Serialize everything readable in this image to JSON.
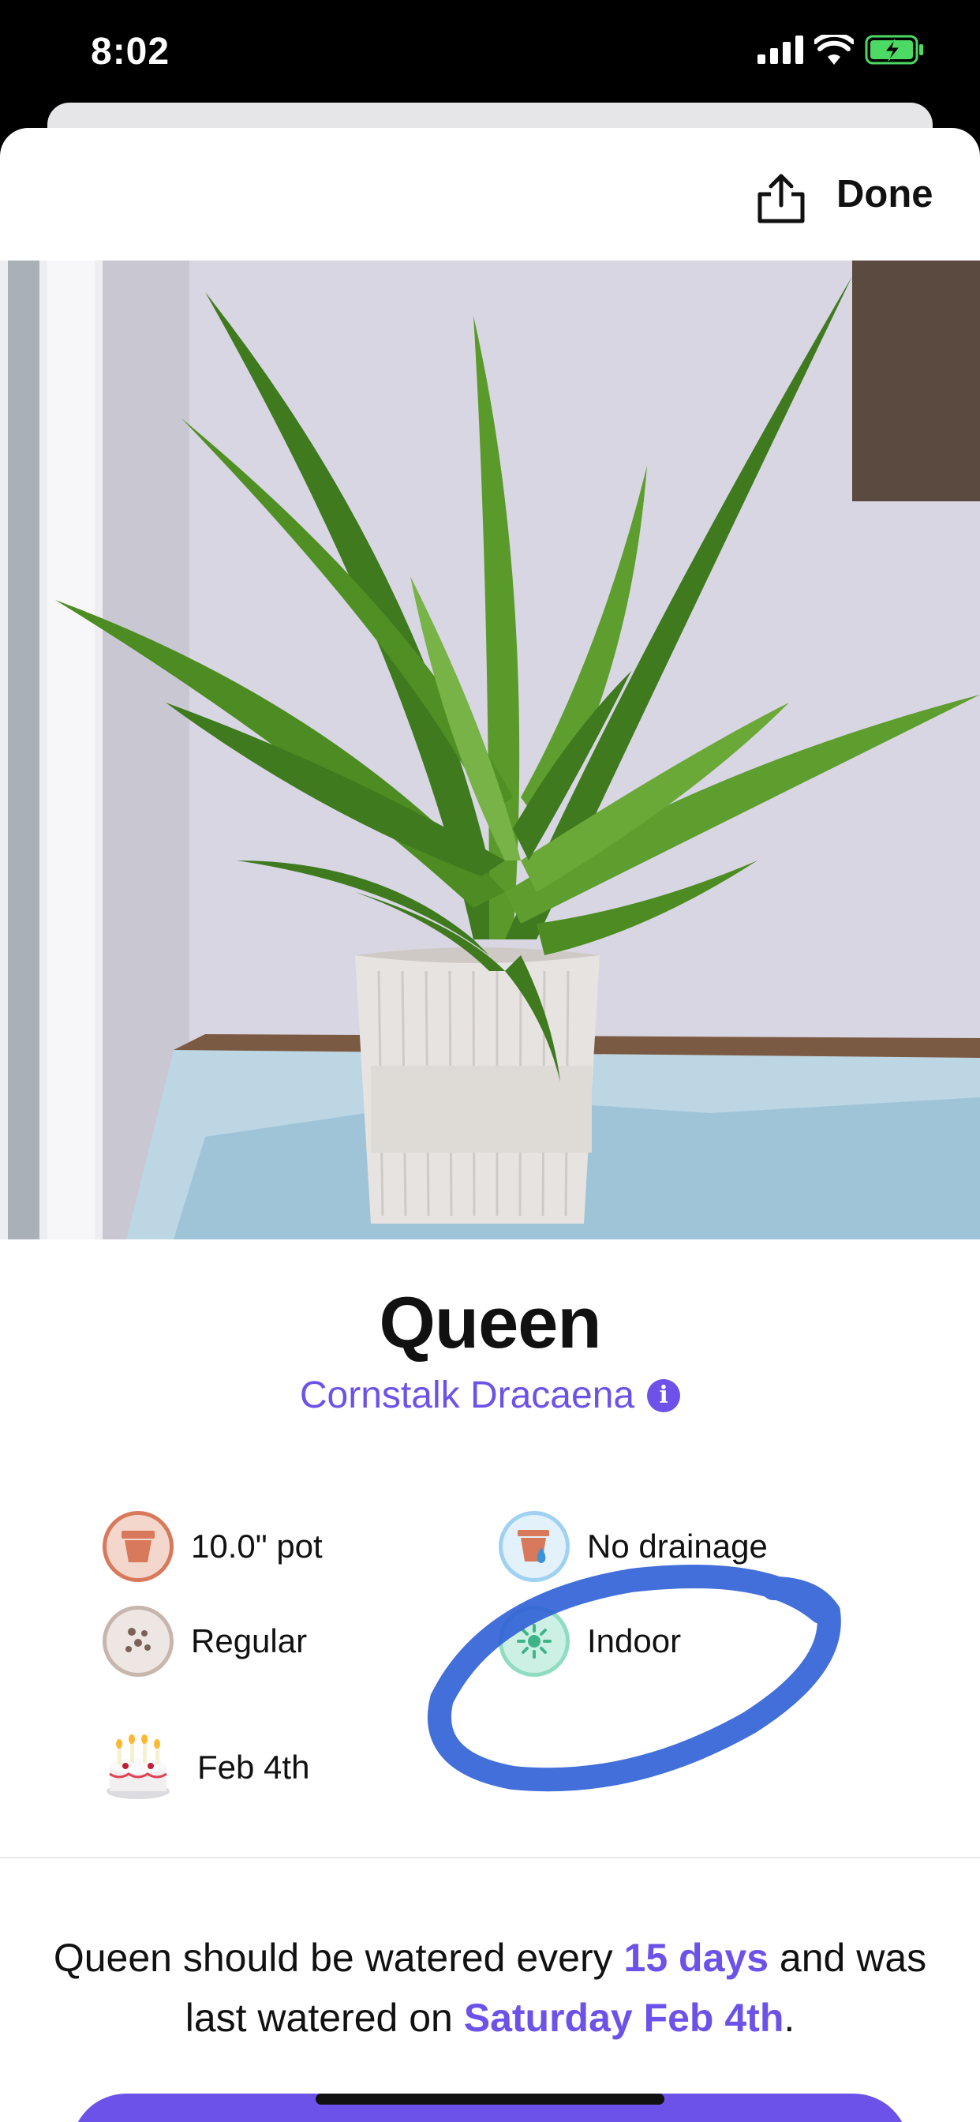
{
  "status_bar": {
    "time": "8:02"
  },
  "header": {
    "done_label": "Done"
  },
  "plant": {
    "name": "Queen",
    "species": "Cornstalk Dracaena"
  },
  "attributes": {
    "pot_size": "10.0\" pot",
    "drainage": "No drainage",
    "soil": "Regular",
    "location": "Indoor",
    "birthday": "Feb 4th"
  },
  "watering": {
    "prefix": "Queen should be watered every ",
    "interval": "15 days",
    "middle": " and was last watered on ",
    "last_watered": "Saturday Feb 4th",
    "suffix": "."
  },
  "colors": {
    "accent": "#6c52e8",
    "scribble": "#2f5fd6"
  }
}
